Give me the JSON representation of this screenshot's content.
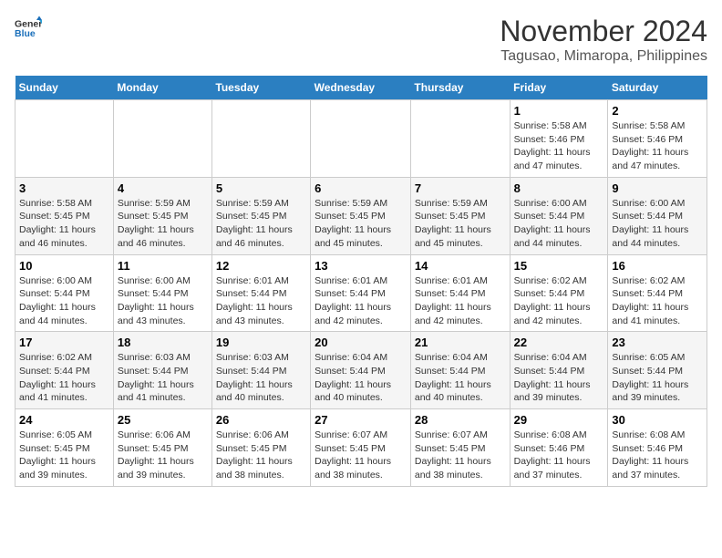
{
  "logo": {
    "line1": "General",
    "line2": "Blue"
  },
  "title": "November 2024",
  "location": "Tagusao, Mimaropa, Philippines",
  "days_of_week": [
    "Sunday",
    "Monday",
    "Tuesday",
    "Wednesday",
    "Thursday",
    "Friday",
    "Saturday"
  ],
  "weeks": [
    [
      {
        "day": "",
        "sunrise": "",
        "sunset": "",
        "daylight": ""
      },
      {
        "day": "",
        "sunrise": "",
        "sunset": "",
        "daylight": ""
      },
      {
        "day": "",
        "sunrise": "",
        "sunset": "",
        "daylight": ""
      },
      {
        "day": "",
        "sunrise": "",
        "sunset": "",
        "daylight": ""
      },
      {
        "day": "",
        "sunrise": "",
        "sunset": "",
        "daylight": ""
      },
      {
        "day": "1",
        "sunrise": "Sunrise: 5:58 AM",
        "sunset": "Sunset: 5:46 PM",
        "daylight": "Daylight: 11 hours and 47 minutes."
      },
      {
        "day": "2",
        "sunrise": "Sunrise: 5:58 AM",
        "sunset": "Sunset: 5:46 PM",
        "daylight": "Daylight: 11 hours and 47 minutes."
      }
    ],
    [
      {
        "day": "3",
        "sunrise": "Sunrise: 5:58 AM",
        "sunset": "Sunset: 5:45 PM",
        "daylight": "Daylight: 11 hours and 46 minutes."
      },
      {
        "day": "4",
        "sunrise": "Sunrise: 5:59 AM",
        "sunset": "Sunset: 5:45 PM",
        "daylight": "Daylight: 11 hours and 46 minutes."
      },
      {
        "day": "5",
        "sunrise": "Sunrise: 5:59 AM",
        "sunset": "Sunset: 5:45 PM",
        "daylight": "Daylight: 11 hours and 46 minutes."
      },
      {
        "day": "6",
        "sunrise": "Sunrise: 5:59 AM",
        "sunset": "Sunset: 5:45 PM",
        "daylight": "Daylight: 11 hours and 45 minutes."
      },
      {
        "day": "7",
        "sunrise": "Sunrise: 5:59 AM",
        "sunset": "Sunset: 5:45 PM",
        "daylight": "Daylight: 11 hours and 45 minutes."
      },
      {
        "day": "8",
        "sunrise": "Sunrise: 6:00 AM",
        "sunset": "Sunset: 5:44 PM",
        "daylight": "Daylight: 11 hours and 44 minutes."
      },
      {
        "day": "9",
        "sunrise": "Sunrise: 6:00 AM",
        "sunset": "Sunset: 5:44 PM",
        "daylight": "Daylight: 11 hours and 44 minutes."
      }
    ],
    [
      {
        "day": "10",
        "sunrise": "Sunrise: 6:00 AM",
        "sunset": "Sunset: 5:44 PM",
        "daylight": "Daylight: 11 hours and 44 minutes."
      },
      {
        "day": "11",
        "sunrise": "Sunrise: 6:00 AM",
        "sunset": "Sunset: 5:44 PM",
        "daylight": "Daylight: 11 hours and 43 minutes."
      },
      {
        "day": "12",
        "sunrise": "Sunrise: 6:01 AM",
        "sunset": "Sunset: 5:44 PM",
        "daylight": "Daylight: 11 hours and 43 minutes."
      },
      {
        "day": "13",
        "sunrise": "Sunrise: 6:01 AM",
        "sunset": "Sunset: 5:44 PM",
        "daylight": "Daylight: 11 hours and 42 minutes."
      },
      {
        "day": "14",
        "sunrise": "Sunrise: 6:01 AM",
        "sunset": "Sunset: 5:44 PM",
        "daylight": "Daylight: 11 hours and 42 minutes."
      },
      {
        "day": "15",
        "sunrise": "Sunrise: 6:02 AM",
        "sunset": "Sunset: 5:44 PM",
        "daylight": "Daylight: 11 hours and 42 minutes."
      },
      {
        "day": "16",
        "sunrise": "Sunrise: 6:02 AM",
        "sunset": "Sunset: 5:44 PM",
        "daylight": "Daylight: 11 hours and 41 minutes."
      }
    ],
    [
      {
        "day": "17",
        "sunrise": "Sunrise: 6:02 AM",
        "sunset": "Sunset: 5:44 PM",
        "daylight": "Daylight: 11 hours and 41 minutes."
      },
      {
        "day": "18",
        "sunrise": "Sunrise: 6:03 AM",
        "sunset": "Sunset: 5:44 PM",
        "daylight": "Daylight: 11 hours and 41 minutes."
      },
      {
        "day": "19",
        "sunrise": "Sunrise: 6:03 AM",
        "sunset": "Sunset: 5:44 PM",
        "daylight": "Daylight: 11 hours and 40 minutes."
      },
      {
        "day": "20",
        "sunrise": "Sunrise: 6:04 AM",
        "sunset": "Sunset: 5:44 PM",
        "daylight": "Daylight: 11 hours and 40 minutes."
      },
      {
        "day": "21",
        "sunrise": "Sunrise: 6:04 AM",
        "sunset": "Sunset: 5:44 PM",
        "daylight": "Daylight: 11 hours and 40 minutes."
      },
      {
        "day": "22",
        "sunrise": "Sunrise: 6:04 AM",
        "sunset": "Sunset: 5:44 PM",
        "daylight": "Daylight: 11 hours and 39 minutes."
      },
      {
        "day": "23",
        "sunrise": "Sunrise: 6:05 AM",
        "sunset": "Sunset: 5:44 PM",
        "daylight": "Daylight: 11 hours and 39 minutes."
      }
    ],
    [
      {
        "day": "24",
        "sunrise": "Sunrise: 6:05 AM",
        "sunset": "Sunset: 5:45 PM",
        "daylight": "Daylight: 11 hours and 39 minutes."
      },
      {
        "day": "25",
        "sunrise": "Sunrise: 6:06 AM",
        "sunset": "Sunset: 5:45 PM",
        "daylight": "Daylight: 11 hours and 39 minutes."
      },
      {
        "day": "26",
        "sunrise": "Sunrise: 6:06 AM",
        "sunset": "Sunset: 5:45 PM",
        "daylight": "Daylight: 11 hours and 38 minutes."
      },
      {
        "day": "27",
        "sunrise": "Sunrise: 6:07 AM",
        "sunset": "Sunset: 5:45 PM",
        "daylight": "Daylight: 11 hours and 38 minutes."
      },
      {
        "day": "28",
        "sunrise": "Sunrise: 6:07 AM",
        "sunset": "Sunset: 5:45 PM",
        "daylight": "Daylight: 11 hours and 38 minutes."
      },
      {
        "day": "29",
        "sunrise": "Sunrise: 6:08 AM",
        "sunset": "Sunset: 5:46 PM",
        "daylight": "Daylight: 11 hours and 37 minutes."
      },
      {
        "day": "30",
        "sunrise": "Sunrise: 6:08 AM",
        "sunset": "Sunset: 5:46 PM",
        "daylight": "Daylight: 11 hours and 37 minutes."
      }
    ]
  ]
}
